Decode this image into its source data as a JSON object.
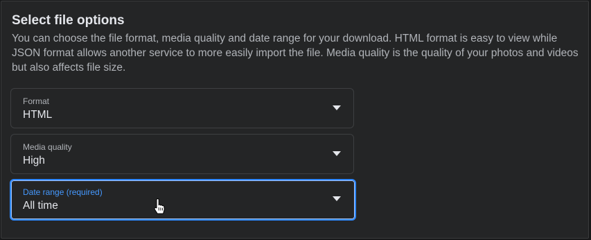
{
  "section": {
    "title": "Select file options",
    "description": "You can choose the file format, media quality and date range for your download. HTML format is easy to view while JSON format allows another service to more easily import the file. Media quality is the quality of your photos and videos but also affects file size."
  },
  "fields": [
    {
      "label": "Format",
      "value": "HTML",
      "icon": "caret-down-icon"
    },
    {
      "label": "Media quality",
      "value": "High",
      "icon": "caret-down-icon"
    },
    {
      "label": "Date range (required)",
      "value": "All time",
      "icon": "caret-down-icon",
      "focused": true
    }
  ],
  "colors": {
    "background": "#242526",
    "text_primary": "#e4e6eb",
    "text_secondary": "#b0b3b8",
    "accent": "#2d88ff"
  },
  "pointer": "hand-pointer-icon"
}
